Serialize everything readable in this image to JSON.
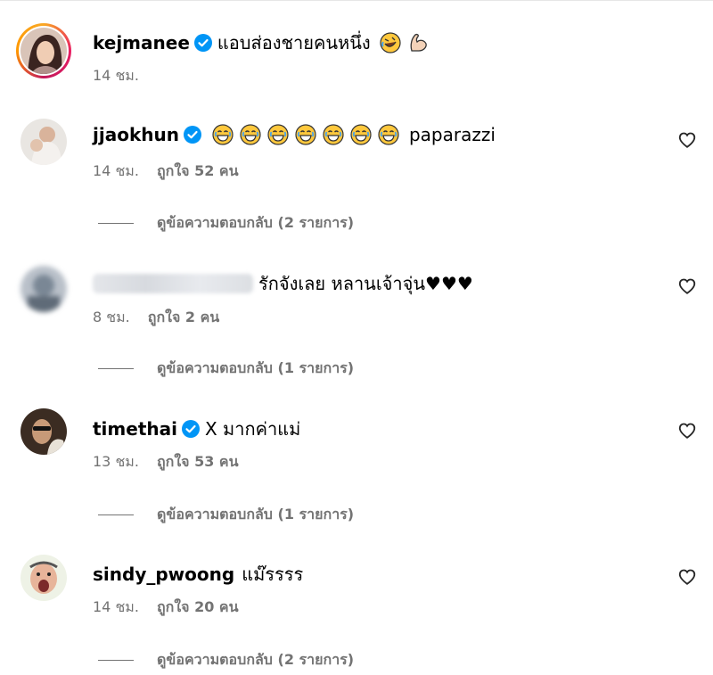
{
  "post": {
    "username": "kejmanee",
    "caption": "แอบส่องชายคนหนึ่ง",
    "caption_emojis": [
      "rolling-laugh-emoji",
      "flexed-biceps-emoji"
    ],
    "time": "14 ชม."
  },
  "comments": [
    {
      "username": "jjaokhun",
      "verified": true,
      "emojis": [
        "grinning-emoji",
        "grinning-emoji",
        "grinning-emoji",
        "grinning-emoji",
        "grinning-emoji",
        "grinning-emoji",
        "grinning-emoji"
      ],
      "text": "paparazzi",
      "time": "14 ชม.",
      "likes": "ถูกใจ 52 คน",
      "replies": "ดูข้อความตอบกลับ (2 รายการ)"
    },
    {
      "username": "",
      "verified": false,
      "text": "รักจังเลย หลานเจ้าจุ่น♥♥♥",
      "time": "8 ชม.",
      "likes": "ถูกใจ 2 คน",
      "replies": "ดูข้อความตอบกลับ (1 รายการ)"
    },
    {
      "username": "timethai",
      "verified": true,
      "text": "X มากค่าแม่",
      "time": "13 ชม.",
      "likes": "ถูกใจ 53 คน",
      "replies": "ดูข้อความตอบกลับ (1 รายการ)"
    },
    {
      "username": "sindy_pwoong",
      "verified": false,
      "text": "แม๊รรรร",
      "time": "14 ชม.",
      "likes": "ถูกใจ 20 คน",
      "replies": "ดูข้อความตอบกลับ (2 รายการ)"
    }
  ],
  "colors": {
    "verified": "#0095f6",
    "meta": "#737373",
    "text": "#000000"
  },
  "icons": {
    "like": "heart-outline-icon",
    "verified": "verified-badge-icon"
  }
}
